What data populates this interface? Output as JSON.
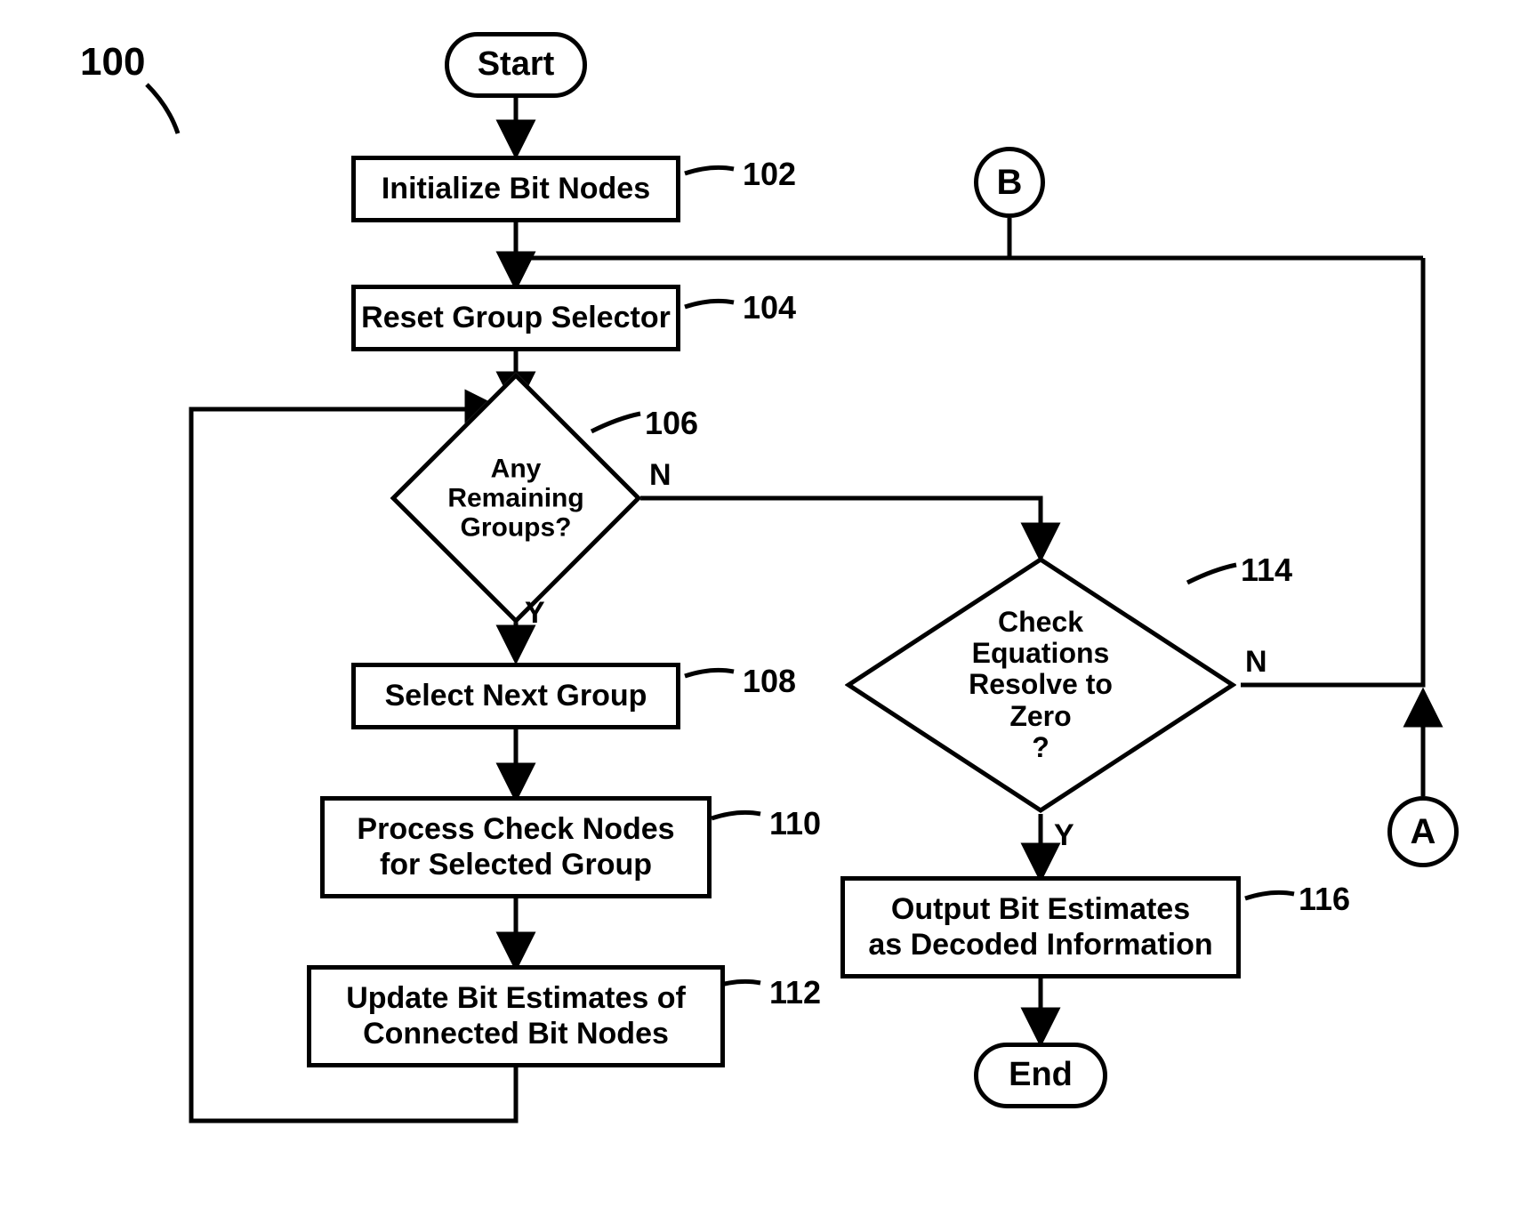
{
  "figure_label": "100",
  "nodes": {
    "start": "Start",
    "end": "End",
    "connector_B": "B",
    "connector_A": "A",
    "box102": "Initialize Bit Nodes",
    "box104": "Reset Group Selector",
    "box108": "Select Next Group",
    "box110": "Process Check Nodes\nfor Selected Group",
    "box112": "Update Bit Estimates of\nConnected Bit Nodes",
    "box116": "Output Bit Estimates\nas Decoded Information",
    "dec106": "Any\nRemaining\nGroups?",
    "dec114": "Check\nEquations\nResolve to Zero\n?"
  },
  "refs": {
    "r102": "102",
    "r104": "104",
    "r106": "106",
    "r108": "108",
    "r110": "110",
    "r112": "112",
    "r114": "114",
    "r116": "116"
  },
  "edges": {
    "y106": "Y",
    "n106": "N",
    "y114": "Y",
    "n114": "N"
  }
}
